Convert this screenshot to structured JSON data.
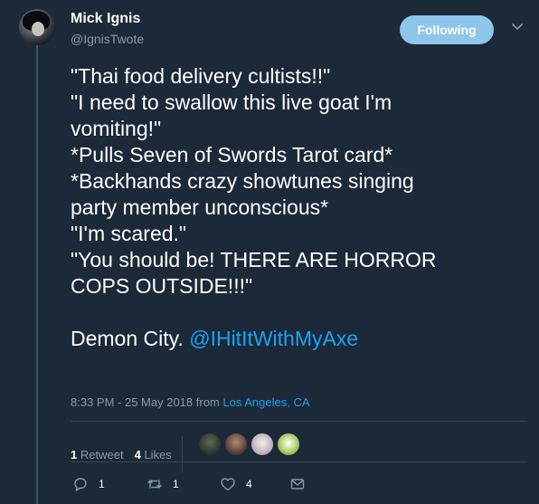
{
  "user": {
    "name": "Mick Ignis",
    "handle": "@IgnisTwote"
  },
  "follow_button": {
    "label": "Following"
  },
  "tweet": {
    "lines": [
      "\"Thai food delivery cultists!!\"",
      "\"I need to swallow this live goat I'm",
      "vomiting!\"",
      "*Pulls Seven of Swords Tarot card*",
      "*Backhands crazy showtunes singing",
      "party member unconscious*",
      "\"I'm scared.\"",
      "\"You should be! THERE ARE HORROR",
      "COPS OUTSIDE!!!\""
    ],
    "closing_text": "Demon City.",
    "mention": "@IHitItWithMyAxe"
  },
  "meta": {
    "timestamp": "8:33 PM - 25 May 2018",
    "from_label": "from",
    "location": "Los Angeles, CA"
  },
  "stats": {
    "retweets_count": "1",
    "retweets_label": "Retweet",
    "likes_count": "4",
    "likes_label": "Likes"
  },
  "likers": [
    {
      "name": "liker-avatar-1",
      "color": "#3b4a3a"
    },
    {
      "name": "liker-avatar-2",
      "color": "#7a5a4a"
    },
    {
      "name": "liker-avatar-3",
      "color": "#d8d0d6"
    },
    {
      "name": "liker-avatar-4",
      "color": "#a6c46a"
    }
  ],
  "actions": {
    "reply_count": "1",
    "retweet_count": "1",
    "like_count": "4"
  },
  "colors": {
    "background": "#1c2938",
    "accent": "#1da1f2",
    "following_button": "#8ec5ea",
    "muted": "#8899a6"
  }
}
